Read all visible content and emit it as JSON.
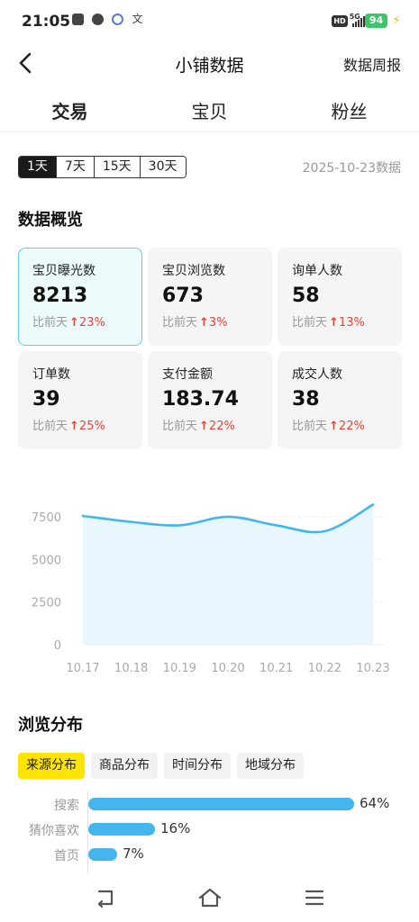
{
  "status_bar": {
    "time": "21:05",
    "left_icons": [
      "mail-icon",
      "chat-icon",
      "app-icon",
      "translate-icon"
    ],
    "hd": "HD",
    "network": "5G",
    "battery": "94"
  },
  "nav": {
    "title": "小铺数据",
    "action": "数据周报"
  },
  "tabs": [
    {
      "label": "交易",
      "active": true
    },
    {
      "label": "宝贝",
      "active": false
    },
    {
      "label": "粉丝",
      "active": false
    }
  ],
  "range": {
    "options": [
      "1天",
      "7天",
      "15天",
      "30天"
    ],
    "selected": "1天",
    "date_label": "2025-10-23数据"
  },
  "overview": {
    "title": "数据概览",
    "compare_label": "比前天",
    "cards": [
      {
        "label": "宝贝曝光数",
        "value": "8213",
        "change": "23%",
        "active": true
      },
      {
        "label": "宝贝浏览数",
        "value": "673",
        "change": "3%",
        "active": false
      },
      {
        "label": "询单人数",
        "value": "58",
        "change": "13%",
        "active": false
      },
      {
        "label": "订单数",
        "value": "39",
        "change": "25%",
        "active": false
      },
      {
        "label": "支付金额",
        "value": "183.74",
        "change": "22%",
        "active": false
      },
      {
        "label": "成交人数",
        "value": "38",
        "change": "22%",
        "active": false
      }
    ]
  },
  "chart_data": {
    "type": "area",
    "x": [
      "10.17",
      "10.18",
      "10.19",
      "10.20",
      "10.21",
      "10.22",
      "10.23"
    ],
    "series": [
      {
        "values": [
          7550,
          7200,
          7000,
          7500,
          7000,
          6650,
          8213
        ]
      }
    ],
    "yticks": [
      0,
      2500,
      5000,
      7500
    ],
    "ylim": [
      0,
      8500
    ],
    "grid": true,
    "color": "#45b5ee",
    "fill": "#e8f6fd"
  },
  "distribution": {
    "title": "浏览分布",
    "tabs": [
      "来源分布",
      "商品分布",
      "时间分布",
      "地域分布"
    ],
    "selected": "来源分布",
    "items": [
      {
        "label": "搜索",
        "value": 64,
        "pct": "64%"
      },
      {
        "label": "猜你喜欢",
        "value": 16,
        "pct": "16%"
      },
      {
        "label": "首页",
        "value": 7,
        "pct": "7%"
      }
    ]
  },
  "home_bar": [
    "back-icon",
    "home-icon",
    "menu-icon"
  ]
}
